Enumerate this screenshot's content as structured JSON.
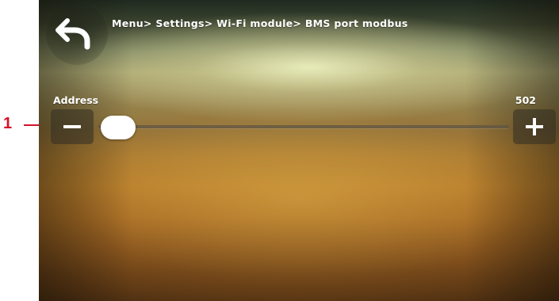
{
  "callout": {
    "number": "1",
    "color": "#d3132a"
  },
  "header": {
    "back_icon": "back-arrow-icon",
    "breadcrumb": "Menu> Settings> Wi-Fi module> BMS port modbus"
  },
  "address": {
    "label": "Address",
    "value": "502",
    "slider_level": 0.0,
    "minus_icon": "minus-icon",
    "plus_icon": "plus-icon"
  },
  "colors": {
    "text": "#ffffff",
    "thumb": "#ffffff",
    "button_bg": "#32302a"
  }
}
